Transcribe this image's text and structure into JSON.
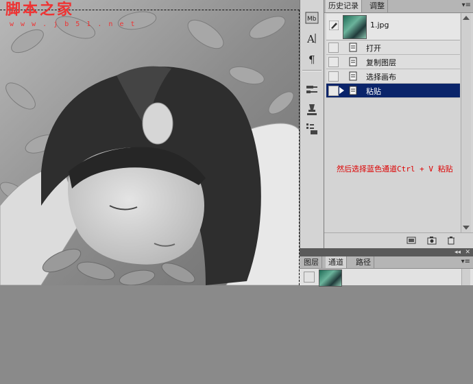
{
  "watermark": {
    "text": "脚本之家",
    "url": "w w w . j b 5 1 . n e t"
  },
  "history_panel": {
    "tabs": [
      {
        "label": "历史记录"
      },
      {
        "label": "调整"
      }
    ],
    "menu_icon": "panel-menu-icon",
    "snapshot": {
      "label": "1.jpg"
    },
    "items": [
      {
        "label": "打开"
      },
      {
        "label": "复制图层"
      },
      {
        "label": "选择画布"
      },
      {
        "label": "粘贴"
      }
    ],
    "selected_index": 3,
    "instruction": "然后选择蓝色通道Ctrl + V 粘贴"
  },
  "layers_panel": {
    "tabs": [
      {
        "label": "图层"
      },
      {
        "label": "通道"
      },
      {
        "label": "路径"
      }
    ],
    "active_tab": "通道"
  },
  "dock_icons": [
    "mini-bridge-icon",
    "character-icon",
    "paragraph-icon",
    "brush-presets-icon",
    "clone-source-icon",
    "tool-presets-icon"
  ],
  "colors": {
    "selection": "#0a246a",
    "instruction": "#dd0000",
    "panel_bg": "#d4d4d4",
    "workspace": "#8a8a8a"
  }
}
